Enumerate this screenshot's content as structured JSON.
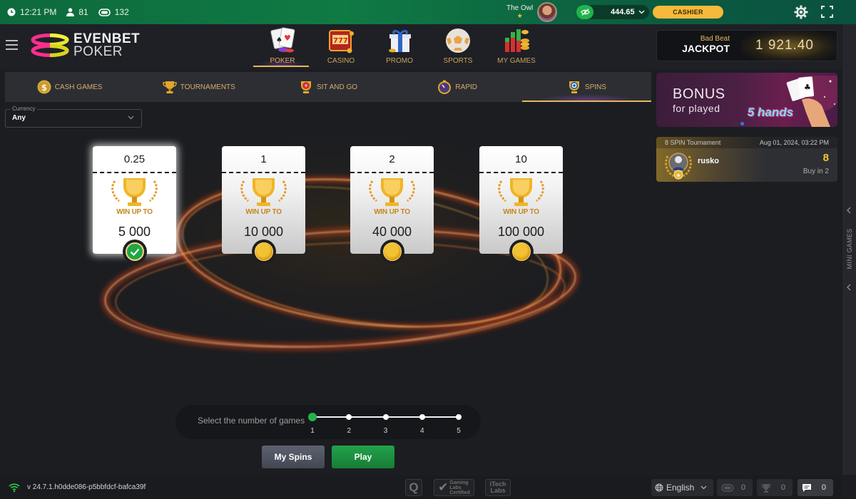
{
  "status_bar": {
    "time": "12:21 PM",
    "players_online": "81",
    "tables_online": "132",
    "user_name": "The Owl",
    "user_star": "★",
    "balance": "444.65",
    "cashier_label": "CASHIER"
  },
  "header": {
    "logo_line1": "EVENBET",
    "logo_line2": "POKER",
    "nav": [
      {
        "label": "POKER",
        "icon": "poker-cards-icon",
        "active": true
      },
      {
        "label": "CASINO",
        "icon": "slot-machine-icon",
        "active": false
      },
      {
        "label": "PROMO",
        "icon": "gift-box-icon",
        "active": false
      },
      {
        "label": "SPORTS",
        "icon": "soccer-ball-icon",
        "active": false
      },
      {
        "label": "MY GAMES",
        "icon": "chart-coins-icon",
        "active": false
      }
    ],
    "jackpot": {
      "label_top": "Bad Beat",
      "label_bottom": "JACKPOT",
      "value": "1 921.40"
    }
  },
  "tabs": [
    {
      "label": "CASH GAMES",
      "icon": "dollar-coin-icon",
      "active": false
    },
    {
      "label": "TOURNAMENTS",
      "icon": "trophy-icon",
      "active": false
    },
    {
      "label": "SIT AND GO",
      "icon": "lightning-cup-icon",
      "active": false
    },
    {
      "label": "RAPID",
      "icon": "stopwatch-icon",
      "active": false
    },
    {
      "label": "SPINS",
      "icon": "spin-cup-icon",
      "active": true
    }
  ],
  "currency_filter": {
    "label": "Currency",
    "value": "Any"
  },
  "spin_cards": [
    {
      "buyin": "0.25",
      "win_label": "WIN UP TO",
      "prize": "5 000",
      "selected": true
    },
    {
      "buyin": "1",
      "win_label": "WIN UP TO",
      "prize": "10 000",
      "selected": false
    },
    {
      "buyin": "2",
      "win_label": "WIN UP TO",
      "prize": "40 000",
      "selected": false
    },
    {
      "buyin": "10",
      "win_label": "WIN UP TO",
      "prize": "100 000",
      "selected": false
    }
  ],
  "game_count": {
    "label": "Select the number of games",
    "options": [
      "1",
      "2",
      "3",
      "4",
      "5"
    ],
    "selected": "1"
  },
  "buttons": {
    "my_spins": "My Spins",
    "play": "Play"
  },
  "promo_banner": {
    "title": "BONUS",
    "subtitle": "for played",
    "brand": "5 hands",
    "slides": 2,
    "active_slide": 2
  },
  "recent_winner": {
    "tournament": "8 SPIN Tournament",
    "datetime": "Aug 01, 2024, 03:22 PM",
    "player": "rusko",
    "prize": "8",
    "buyin": "Buy in 2"
  },
  "side_panel": {
    "label": "MINI GAMES"
  },
  "footer": {
    "version": "v 24.7.1.h0dde086-p5bbfdcf-bafca39f",
    "cert_q": "Q",
    "cert_gaming_labs": [
      "Gaming",
      "Labs",
      "Certified"
    ],
    "cert_itech": [
      "iTech",
      "Labs"
    ],
    "language": "English",
    "counters": [
      {
        "icon": "tables-icon",
        "value": "0"
      },
      {
        "icon": "trophy-icon",
        "value": "0"
      },
      {
        "icon": "chat-icon",
        "value": "0"
      }
    ]
  },
  "colors": {
    "accent_gold": "#e6b85a",
    "status_green": "#0f7a44",
    "play_green": "#1e9a44",
    "cashier_yellow": "#f6b93b",
    "background": "#1c1d21"
  }
}
